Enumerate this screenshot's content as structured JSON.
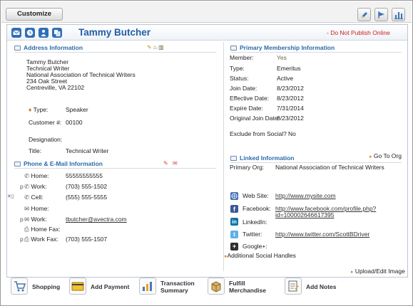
{
  "toolbar": {
    "customize_label": "Customize"
  },
  "header": {
    "name": "Tammy Butcher",
    "notice": "- Do Not Publish Online"
  },
  "address": {
    "title": "Address Information",
    "lines": [
      "Tammy Butcher",
      "Technical Writer",
      "National Association of Technical Writers",
      "234 Oak Street",
      "Centreville, VA 22102"
    ],
    "type_label": "Type:",
    "type_value": "Speaker",
    "customer_label": "Customer #:",
    "customer_value": "00100",
    "designation_label": "Designation:",
    "title_label": "Title:",
    "title_value": "Technical Writer"
  },
  "phone": {
    "title": "Phone & E-Mail Information",
    "rows": [
      {
        "prefix": "",
        "label": "Home:",
        "value": "55555555555"
      },
      {
        "prefix": "p",
        "label": "Work:",
        "value": "(703) 555-1502"
      },
      {
        "prefix": "",
        "label": "Cell:",
        "value": "(555) 555-5555"
      },
      {
        "prefix": "",
        "label": "Home:",
        "value": ""
      },
      {
        "prefix": "p",
        "label": "Work:",
        "value": "tbutcher@avectra.com"
      },
      {
        "prefix": "",
        "label": "Home Fax:",
        "value": ""
      },
      {
        "prefix": "p",
        "label": "Work Fax:",
        "value": "(703) 555-1507"
      }
    ]
  },
  "membership": {
    "title": "Primary Membership Information",
    "rows": [
      {
        "label": "Member:",
        "value": "Yes"
      },
      {
        "label": "Type:",
        "value": "Emeritus"
      },
      {
        "label": "Status:",
        "value": "Active"
      },
      {
        "label": "Join Date:",
        "value": "8/23/2012"
      },
      {
        "label": "Effective Date:",
        "value": "8/23/2012"
      },
      {
        "label": "Expire Date:",
        "value": "7/31/2014"
      },
      {
        "label": "Original Join Date:",
        "value": "8/23/2012"
      }
    ],
    "exclude_label": "Exclude from Social?",
    "exclude_value": "No"
  },
  "linked": {
    "title": "Linked Information",
    "goto_label": "Go To Org",
    "org_label": "Primary Org:",
    "org_value": "National Association of Technical Writers"
  },
  "social": {
    "rows": [
      {
        "label": "Web Site:",
        "value": "http://www.mysite.com"
      },
      {
        "label": "Facebook:",
        "value": "http://www.facebook.com/profile.php?",
        "value2": "id=100002646617395"
      },
      {
        "label": "LinkedIn:",
        "value": ""
      },
      {
        "label": "Twitter:",
        "value": "http://www.twitter.com/ScottBDriver"
      },
      {
        "label": "Google+:",
        "value": ""
      }
    ],
    "additional_label": "Additional Social Handles",
    "upload_label": "Upload/Edit Image"
  },
  "actions": [
    {
      "label": "Shopping",
      "label2": ""
    },
    {
      "label": "Add Payment",
      "label2": ""
    },
    {
      "label": "Transaction",
      "label2": "Summary"
    },
    {
      "label": "Fulfill",
      "label2": "Merchandise"
    },
    {
      "label": "Add Notes",
      "label2": ""
    }
  ],
  "colors": {
    "accent": "#1f5ea8",
    "warning": "#cc1d1d",
    "link_arrow": "#e27a14"
  }
}
